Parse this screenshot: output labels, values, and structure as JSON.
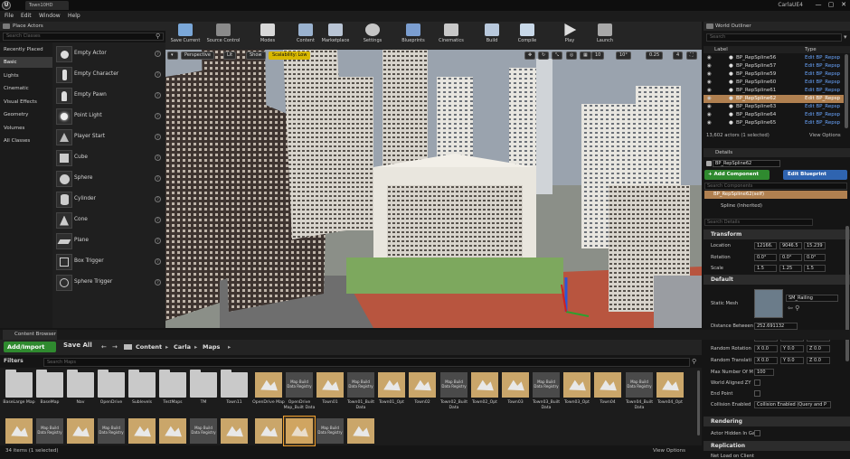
{
  "titlebar": {
    "map_tab": "Town10HD",
    "project": "CarlaUE4",
    "min": "—",
    "max": "▢",
    "close": "✕"
  },
  "menu": [
    "File",
    "Edit",
    "Window",
    "Help"
  ],
  "place_actors": {
    "title": "Place Actors",
    "search_placeholder": "Search Classes",
    "categories": [
      "Recently Placed",
      "Basic",
      "Lights",
      "Cinematic",
      "Visual Effects",
      "Geometry",
      "Volumes",
      "All Classes"
    ],
    "selected_category": "Basic",
    "actors": [
      "Empty Actor",
      "Empty Character",
      "Empty Pawn",
      "Point Light",
      "Player Start",
      "Cube",
      "Sphere",
      "Cylinder",
      "Cone",
      "Plane",
      "Box Trigger",
      "Sphere Trigger"
    ]
  },
  "toolbar": {
    "items": [
      "Save Current",
      "Source Control",
      "Modes",
      "Content",
      "Marketplace",
      "Settings",
      "Blueprints",
      "Cinematics",
      "Build",
      "Compile",
      "Play",
      "Launch"
    ]
  },
  "viewport": {
    "perspective": "Perspective",
    "lit": "Lit",
    "show": "Show",
    "scalability": "Scalability: Low",
    "grid": "10",
    "angle": "10°",
    "scale": "0.25",
    "cam": "4"
  },
  "outliner": {
    "title": "World Outliner",
    "search_placeholder": "Search",
    "col_label": "Label",
    "col_type": "Type",
    "rows": [
      {
        "label": "BP_RepSpline56",
        "type": "Edit BP_Repsp"
      },
      {
        "label": "BP_RepSpline57",
        "type": "Edit BP_Repsp"
      },
      {
        "label": "BP_RepSpline59",
        "type": "Edit BP_Repsp"
      },
      {
        "label": "BP_RepSpline60",
        "type": "Edit BP_Repsp"
      },
      {
        "label": "BP_RepSpline61",
        "type": "Edit BP_Repsp"
      },
      {
        "label": "BP_RepSpline62",
        "type": "Edit BP_Repsp"
      },
      {
        "label": "BP_RepSpline63",
        "type": "Edit BP_Repsp"
      },
      {
        "label": "BP_RepSpline64",
        "type": "Edit BP_Repsp"
      },
      {
        "label": "BP_RepSpline65",
        "type": "Edit BP_Repsp"
      }
    ],
    "selected_index": 5,
    "status": "13,602 actors (1 selected)",
    "view_options": "View Options"
  },
  "details": {
    "title": "Details",
    "name": "BP_RepSpline62",
    "add_component": "+ Add Component",
    "edit_blueprint": "Edit Blueprint",
    "search_components": "Search Components",
    "self": "BP_RepSpline62(self)",
    "spline": "Spline (Inherited)",
    "search_details": "Search Details",
    "transform": "Transform",
    "location": "Location",
    "rotation": "Rotation",
    "scale": "Scale",
    "loc": [
      "12166.",
      "9046.5",
      "15.239"
    ],
    "rot": [
      "0.0°",
      "0.0°",
      "0.0°"
    ],
    "scl": [
      "1.5",
      "1.25",
      "1.5"
    ],
    "default": "Default",
    "static_mesh": "Static Mesh",
    "sm_value": "SM_Railing",
    "distance_between": "Distance Between",
    "distance_value": "252.691132",
    "fixed_rot": "Fixed Rotation Om",
    "random_rot": "Random Rotation",
    "random_trans": "Random Translati",
    "xyz": [
      "X 0.0",
      "Y 0.0",
      "Z 0.0"
    ],
    "max_number": "Max Number Of M",
    "max_value": "100",
    "world_aligned": "World Aligned ZY",
    "end_point": "End Point",
    "collision": "Collision Enabled",
    "collision_value": "Collision Enabled (Query and P",
    "rendering": "Rendering",
    "actor_hidden": "Actor Hidden In Ga",
    "replication": "Replication",
    "net_load": "Net Load on Client"
  },
  "content_browser": {
    "title": "Content Browser",
    "add_import": "Add/Import",
    "save_all": "Save All",
    "path": [
      "Content",
      "Carla",
      "Maps"
    ],
    "filters": "Filters",
    "search_placeholder": "Search Maps",
    "row1": [
      {
        "name": "BaseLarge Map",
        "kind": "folder"
      },
      {
        "name": "BaseMap",
        "kind": "folder"
      },
      {
        "name": "Nav",
        "kind": "folder"
      },
      {
        "name": "OpenDrive",
        "kind": "folder"
      },
      {
        "name": "Sublevels",
        "kind": "folder"
      },
      {
        "name": "TestMaps",
        "kind": "folder"
      },
      {
        "name": "TM",
        "kind": "folder"
      },
      {
        "name": "Town11",
        "kind": "folder"
      },
      {
        "name": "OpenDrive Map",
        "kind": "map"
      },
      {
        "name": "OpenDrive Map_Built Data",
        "kind": "bd"
      },
      {
        "name": "Town01",
        "kind": "map"
      },
      {
        "name": "Town01_Built Data",
        "kind": "bd"
      },
      {
        "name": "Town01_Opt",
        "kind": "map"
      },
      {
        "name": "Town02",
        "kind": "map"
      },
      {
        "name": "Town02_Built Data",
        "kind": "bd"
      },
      {
        "name": "Town02_Opt",
        "kind": "map"
      },
      {
        "name": "Town03",
        "kind": "map"
      },
      {
        "name": "Town03_Built Data",
        "kind": "bd"
      },
      {
        "name": "Town03_Opt",
        "kind": "map"
      },
      {
        "name": "Town04",
        "kind": "map"
      },
      {
        "name": "Town04_Built Data",
        "kind": "bd"
      },
      {
        "name": "Town04_Opt",
        "kind": "map"
      }
    ],
    "row2": [
      "map",
      "bd",
      "map",
      "bd",
      "map",
      "map",
      "bd",
      "map",
      "map",
      "map",
      "bd",
      "map"
    ],
    "bd_label": "Map Build Data Registry",
    "status": "34 items (1 selected)",
    "view_options": "View Options"
  }
}
